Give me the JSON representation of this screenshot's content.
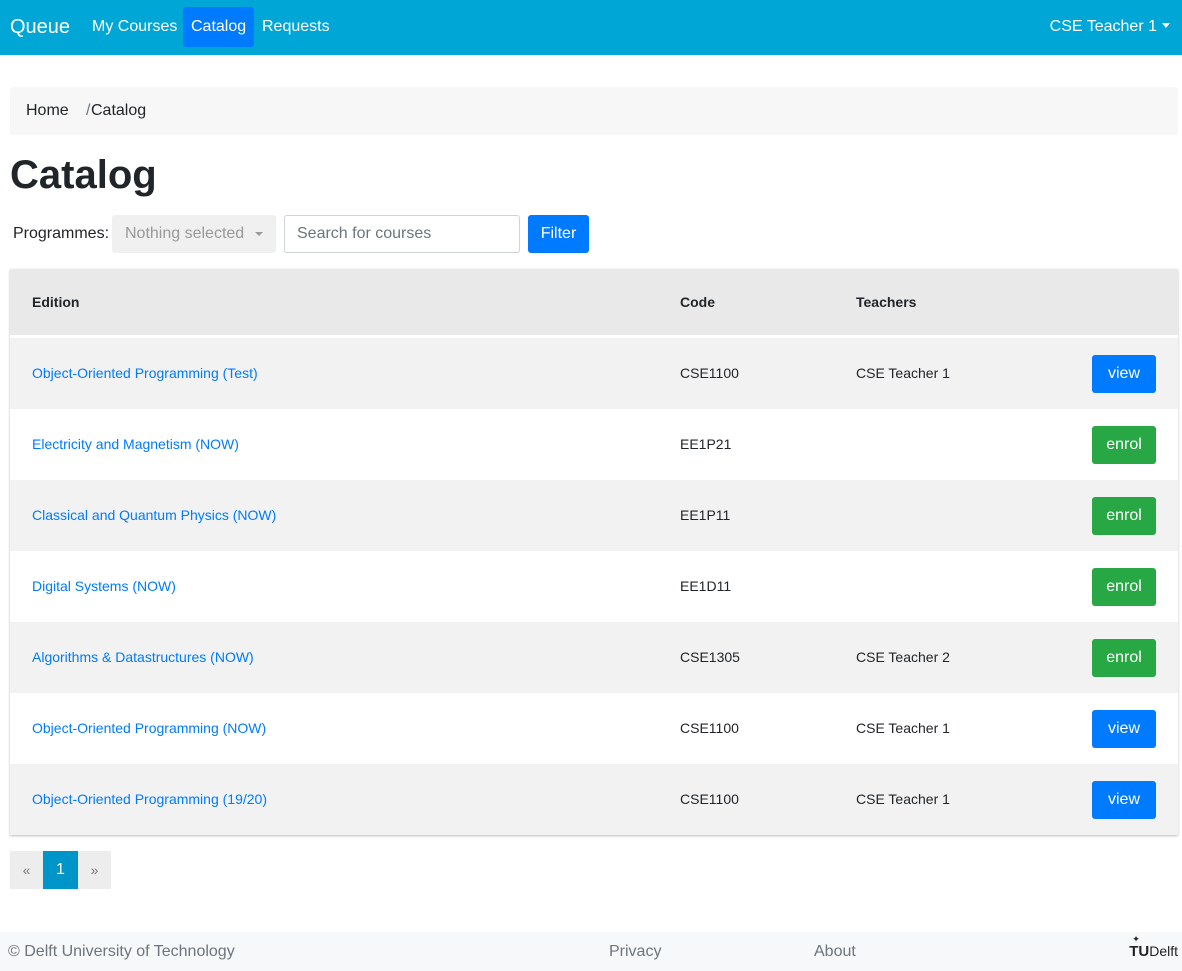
{
  "navbar": {
    "brand": "Queue",
    "items": [
      {
        "label": "My Courses"
      },
      {
        "label": "Catalog",
        "active": true
      },
      {
        "label": "Requests"
      }
    ],
    "user": "CSE Teacher 1",
    "color": "#00a6d6"
  },
  "breadcrumb": {
    "home": "Home",
    "separator": "/",
    "current": "Catalog"
  },
  "page_title": "Catalog",
  "filters": {
    "programmes_label": "Programmes:",
    "programmes_value": "Nothing selected",
    "search_placeholder": "Search for courses",
    "filter_label": "Filter"
  },
  "table": {
    "headers": {
      "edition": "Edition",
      "code": "Code",
      "teachers": "Teachers"
    },
    "rows": [
      {
        "edition": "Object-Oriented Programming (Test)",
        "code": "CSE1100",
        "teachers": "CSE Teacher 1",
        "action": "view"
      },
      {
        "edition": "Electricity and Magnetism (NOW)",
        "code": "EE1P21",
        "teachers": "",
        "action": "enrol"
      },
      {
        "edition": "Classical and Quantum Physics (NOW)",
        "code": "EE1P11",
        "teachers": "",
        "action": "enrol"
      },
      {
        "edition": "Digital Systems (NOW)",
        "code": "EE1D11",
        "teachers": "",
        "action": "enrol"
      },
      {
        "edition": "Algorithms & Datastructures (NOW)",
        "code": "CSE1305",
        "teachers": "CSE Teacher 2",
        "action": "enrol"
      },
      {
        "edition": "Object-Oriented Programming (NOW)",
        "code": "CSE1100",
        "teachers": "CSE Teacher 1",
        "action": "view"
      },
      {
        "edition": "Object-Oriented Programming (19/20)",
        "code": "CSE1100",
        "teachers": "CSE Teacher 1",
        "action": "view"
      }
    ]
  },
  "pagination": {
    "prev": "«",
    "current": "1",
    "next": "»"
  },
  "footer": {
    "copyright": "© Delft University of Technology",
    "privacy": "Privacy",
    "about": "About",
    "logo_tu": "TU",
    "logo_delft": "Delft"
  },
  "colors": {
    "primary": "#007bff",
    "success": "#28a745",
    "navbar": "#00a6d6"
  }
}
